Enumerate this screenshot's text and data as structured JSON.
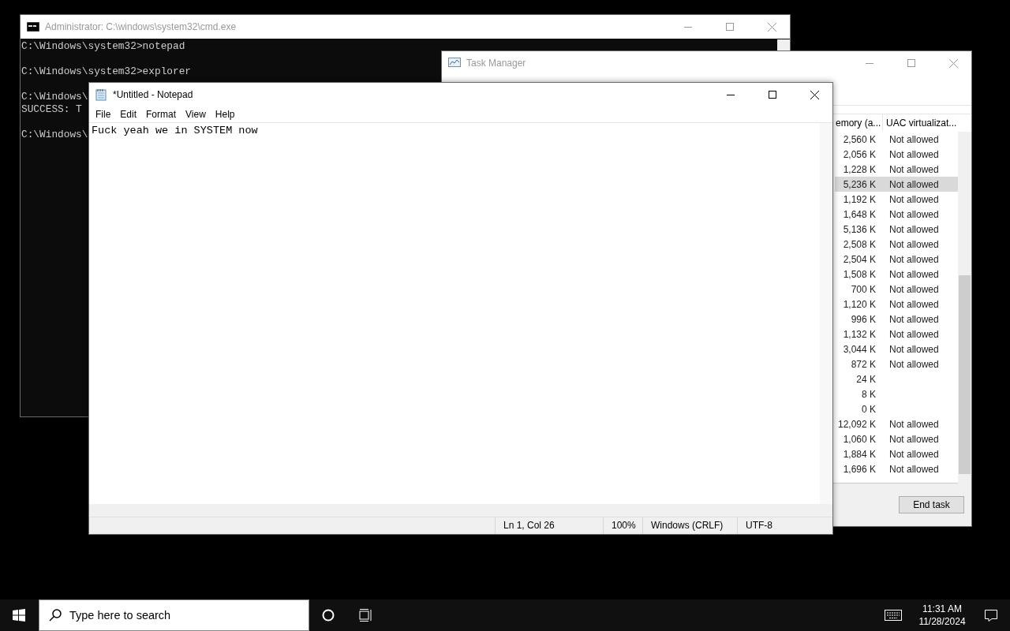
{
  "console_window": {
    "title": "Administrator: C:\\windows\\system32\\cmd.exe",
    "blocks": [
      [
        "C:\\Windows\\system32>notepad"
      ],
      [
        "C:\\Windows\\system32>explorer"
      ],
      [
        "C:\\Windows\\",
        "SUCCESS: T"
      ],
      [
        "C:\\Windows\\"
      ]
    ]
  },
  "task_manager": {
    "title": "Task Manager",
    "columns": [
      "emory (a...",
      "UAC virtualizat..."
    ],
    "rows": [
      {
        "memory": "2,560 K",
        "uac": "Not allowed",
        "selected": false
      },
      {
        "memory": "2,056 K",
        "uac": "Not allowed",
        "selected": false
      },
      {
        "memory": "1,228 K",
        "uac": "Not allowed",
        "selected": false
      },
      {
        "memory": "5,236 K",
        "uac": "Not allowed",
        "selected": true
      },
      {
        "memory": "1,192 K",
        "uac": "Not allowed",
        "selected": false
      },
      {
        "memory": "1,648 K",
        "uac": "Not allowed",
        "selected": false
      },
      {
        "memory": "5,136 K",
        "uac": "Not allowed",
        "selected": false
      },
      {
        "memory": "2,508 K",
        "uac": "Not allowed",
        "selected": false
      },
      {
        "memory": "2,504 K",
        "uac": "Not allowed",
        "selected": false
      },
      {
        "memory": "1,508 K",
        "uac": "Not allowed",
        "selected": false
      },
      {
        "memory": "700 K",
        "uac": "Not allowed",
        "selected": false
      },
      {
        "memory": "1,120 K",
        "uac": "Not allowed",
        "selected": false
      },
      {
        "memory": "996 K",
        "uac": "Not allowed",
        "selected": false
      },
      {
        "memory": "1,132 K",
        "uac": "Not allowed",
        "selected": false
      },
      {
        "memory": "3,044 K",
        "uac": "Not allowed",
        "selected": false
      },
      {
        "memory": "872 K",
        "uac": "Not allowed",
        "selected": false
      },
      {
        "memory": "24 K",
        "selected": false
      },
      {
        "memory": "8 K",
        "selected": false
      },
      {
        "memory": "0 K",
        "selected": false
      },
      {
        "memory": "12,092 K",
        "uac": "Not allowed",
        "selected": false
      },
      {
        "memory": "1,060 K",
        "uac": "Not allowed",
        "selected": false
      },
      {
        "memory": "1,884 K",
        "uac": "Not allowed",
        "selected": false
      },
      {
        "memory": "1,696 K",
        "uac": "Not allowed",
        "selected": false
      }
    ],
    "end_task_button": "End task"
  },
  "notepad": {
    "title": "*Untitled - Notepad",
    "menu": [
      "File",
      "Edit",
      "Format",
      "View",
      "Help"
    ],
    "text": "Fuck yeah we in SYSTEM now",
    "status_bar": [
      "Ln 1, Col 26",
      "100%",
      "Windows (CRLF)",
      "UTF-8"
    ]
  },
  "taskbar": {
    "search_placeholder": "Type here to search",
    "time": "11:31 AM",
    "date": "11/28/2024"
  }
}
